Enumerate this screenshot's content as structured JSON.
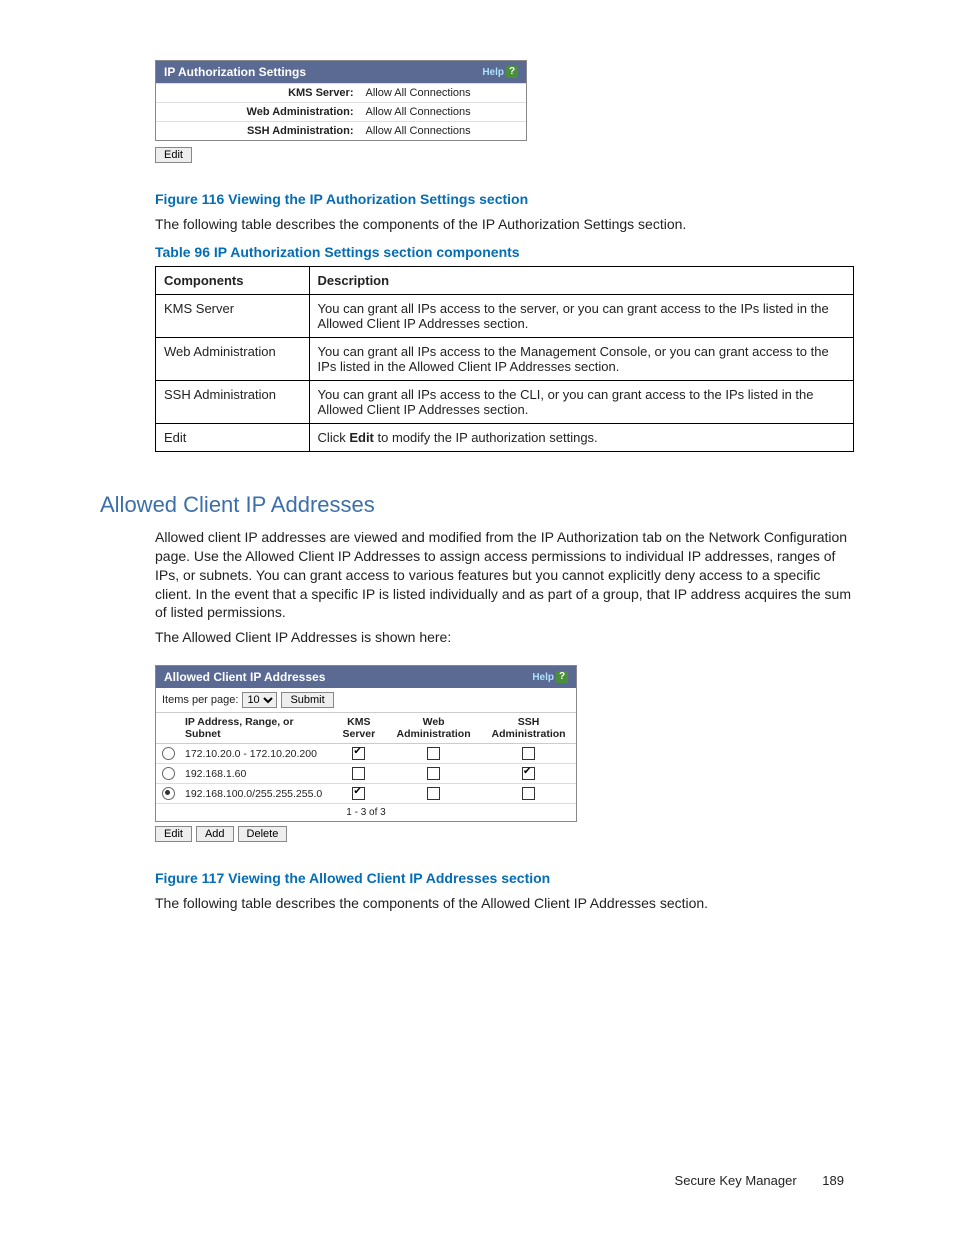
{
  "panel1": {
    "title": "IP Authorization Settings",
    "help": "Help",
    "rows": [
      {
        "label": "KMS Server:",
        "value": "Allow All Connections"
      },
      {
        "label": "Web Administration:",
        "value": "Allow All Connections"
      },
      {
        "label": "SSH Administration:",
        "value": "Allow All Connections"
      }
    ],
    "edit": "Edit"
  },
  "figure116": "Figure 116 Viewing the IP Authorization Settings section",
  "para1": "The following table describes the components of the IP Authorization Settings section.",
  "table96_caption": "Table 96 IP Authorization Settings section components",
  "table96": {
    "headers": [
      "Components",
      "Description"
    ],
    "rows": [
      {
        "c": "KMS Server",
        "d": "You can grant all IPs access to the server, or you can grant access to the IPs listed in the Allowed Client IP Addresses section."
      },
      {
        "c": "Web Administration",
        "d": "You can grant all IPs access to the Management Console, or you can grant access to the IPs listed in the Allowed Client IP Addresses section."
      },
      {
        "c": "SSH Administration",
        "d": "You can grant all IPs access to the CLI, or you can grant access to the IPs listed in the Allowed Client IP Addresses section."
      },
      {
        "c": "Edit",
        "d_pre": "Click ",
        "d_bold": "Edit",
        "d_post": " to modify the IP authorization settings."
      }
    ]
  },
  "section_heading": "Allowed Client IP Addresses",
  "para2": "Allowed client IP addresses are viewed and modified from the IP Authorization tab on the Network Configuration page. Use the Allowed Client IP Addresses to assign access permissions to individual IP addresses, ranges of IPs, or subnets. You can grant access to various features but you cannot explicitly deny access to a specific client. In the event that a specific IP is listed individually and as part of a group, that IP address acquires the sum of listed permissions.",
  "para3": "The Allowed Client IP Addresses is shown here:",
  "panel2": {
    "title": "Allowed Client IP Addresses",
    "help": "Help",
    "items_label": "Items per page:",
    "items_value": "10",
    "submit": "Submit",
    "headers": [
      "IP Address, Range, or Subnet",
      "KMS Server",
      "Web Administration",
      "SSH Administration"
    ],
    "rows": [
      {
        "selected": false,
        "ip": "172.10.20.0 - 172.10.20.200",
        "kms": true,
        "web": false,
        "ssh": false
      },
      {
        "selected": false,
        "ip": "192.168.1.60",
        "kms": false,
        "web": false,
        "ssh": true
      },
      {
        "selected": true,
        "ip": "192.168.100.0/255.255.255.0",
        "kms": true,
        "web": false,
        "ssh": false
      }
    ],
    "pager": "1 - 3 of 3",
    "edit": "Edit",
    "add": "Add",
    "delete": "Delete"
  },
  "figure117": "Figure 117 Viewing the Allowed Client IP Addresses section",
  "para4": "The following table describes the components of the Allowed Client IP Addresses section.",
  "footer": {
    "title": "Secure Key Manager",
    "page": "189"
  }
}
